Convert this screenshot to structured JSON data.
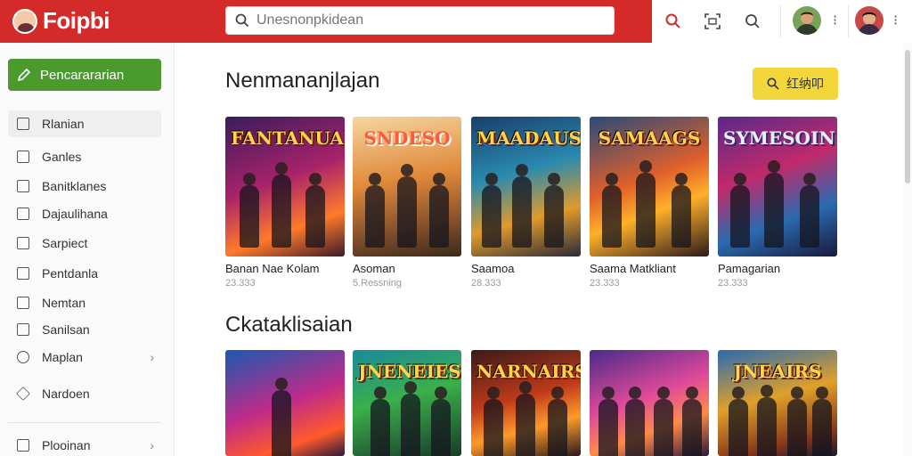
{
  "header": {
    "brand": "Foipbi",
    "search_placeholder": "Unesnonpkidean",
    "icons": [
      "search-red-icon",
      "scan-icon",
      "search-icon"
    ]
  },
  "sidebar": {
    "primary_button": "Pencarararian",
    "items": [
      {
        "label": "Rlanian",
        "icon": "home-icon"
      },
      {
        "label": "Ganles",
        "icon": "games-icon"
      },
      {
        "label": "Banitklanes",
        "icon": "folder-icon"
      },
      {
        "label": "Dajaulihana",
        "icon": "tag-icon"
      },
      {
        "label": "Sarpiect",
        "icon": "store-icon"
      },
      {
        "label": "Pentdanla",
        "icon": "document-icon"
      },
      {
        "label": "Nemtan",
        "icon": "bookmark-icon"
      },
      {
        "label": "Sanilsan",
        "icon": "list-icon"
      },
      {
        "label": "Maplan",
        "icon": "map-icon"
      },
      {
        "label": "Nardoen",
        "icon": "diamond-icon"
      },
      {
        "label": "Plooinan",
        "icon": "smile-icon"
      }
    ]
  },
  "main": {
    "section1": {
      "title": "Nenmananjlajan",
      "button_label": "红纳叩",
      "cards": [
        {
          "cover_title": "FANTANUAI",
          "name": "Banan Nae Kolam",
          "meta": "23.333"
        },
        {
          "cover_title": "SNDESO",
          "name": "Asoman",
          "meta": "5.Ressning"
        },
        {
          "cover_title": "MAADAUS",
          "name": "Saamoa",
          "meta": "28.333"
        },
        {
          "cover_title": "SAMAAGS",
          "name": "Saama Matkliant",
          "meta": "23.333"
        },
        {
          "cover_title": "SYMESOIN",
          "name": "Pamagarian",
          "meta": "23.333"
        }
      ]
    },
    "section2": {
      "title": "Ckataklisaian",
      "cards": [
        {
          "cover_title": ""
        },
        {
          "cover_title": "JNENEIES"
        },
        {
          "cover_title": "NARNAIRS"
        },
        {
          "cover_title": ""
        },
        {
          "cover_title": "JNEAIRS"
        }
      ]
    }
  },
  "colors": {
    "brand_red": "#d42a2a",
    "primary_green": "#4a9a2e",
    "accent_yellow": "#f2d63a"
  }
}
